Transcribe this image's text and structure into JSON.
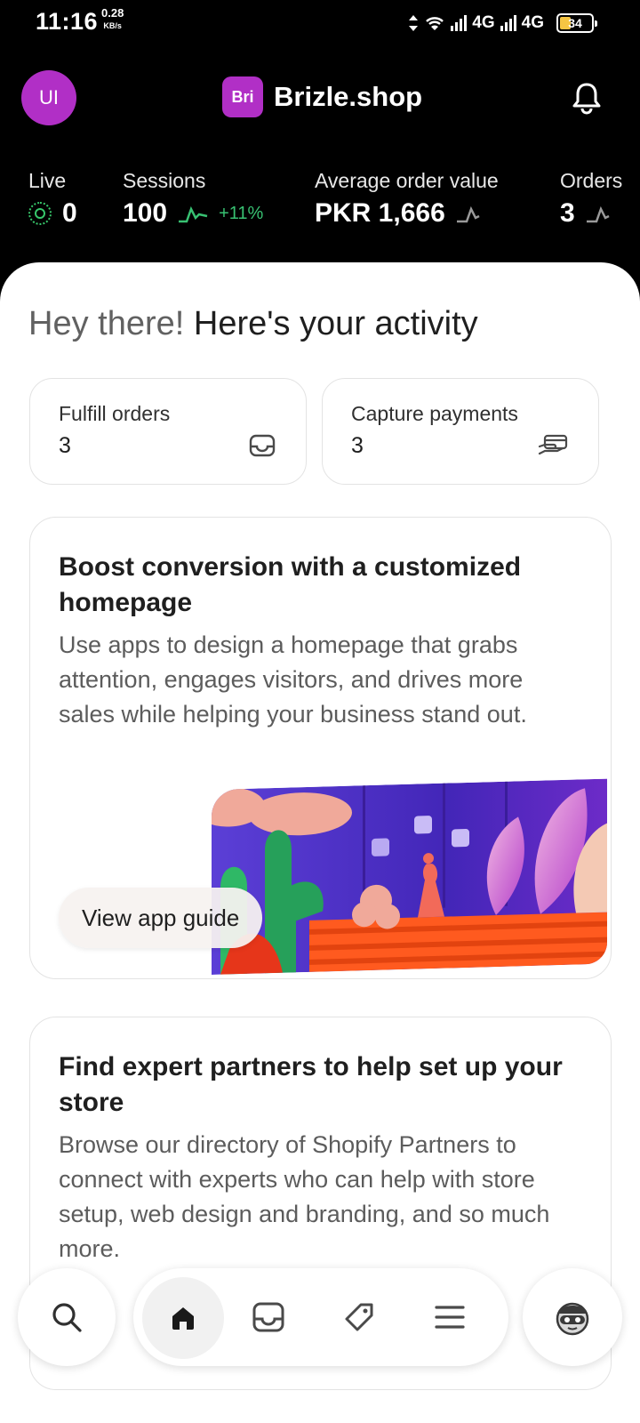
{
  "status_bar": {
    "time": "11:16",
    "speed_value": "0.28",
    "speed_unit": "KB/s",
    "network_1": "4G",
    "network_2": "4G",
    "battery": "34"
  },
  "header": {
    "avatar_initials": "UI",
    "store_badge": "Bri",
    "store_name": "Brizle.shop",
    "icons": [
      "bell-icon"
    ]
  },
  "metrics": [
    {
      "label": "Live",
      "value": "0"
    },
    {
      "label": "Sessions",
      "value": "100",
      "trend": "+11%"
    },
    {
      "label": "Average order value",
      "value": "PKR 1,666"
    },
    {
      "label": "Orders",
      "value": "3"
    }
  ],
  "greeting": {
    "muted": "Hey there!",
    "main": "Here's your activity"
  },
  "tasks": [
    {
      "label": "Fulfill orders",
      "count": "3",
      "icon": "inbox-icon"
    },
    {
      "label": "Capture payments",
      "count": "3",
      "icon": "card-payment-icon"
    }
  ],
  "promo": {
    "title": "Boost conversion with a customized homepage",
    "body": "Use apps to design a homepage that grabs attention, engages visitors, and drives more sales while helping your business stand out.",
    "button": "View app guide"
  },
  "partner": {
    "title": "Find expert partners to help set up your store",
    "body": "Browse our directory of Shopify Partners to connect with experts who can help with store setup, web design and branding, and so much more."
  },
  "bottom_nav": {
    "items": [
      "search-icon",
      "home-icon",
      "orders-icon",
      "tag-icon",
      "menu-icon",
      "assistant-icon"
    ],
    "active": "home-icon"
  },
  "colors": {
    "brand": "#b12fc6",
    "trend_up": "#38c172",
    "header_bg": "#000000"
  }
}
